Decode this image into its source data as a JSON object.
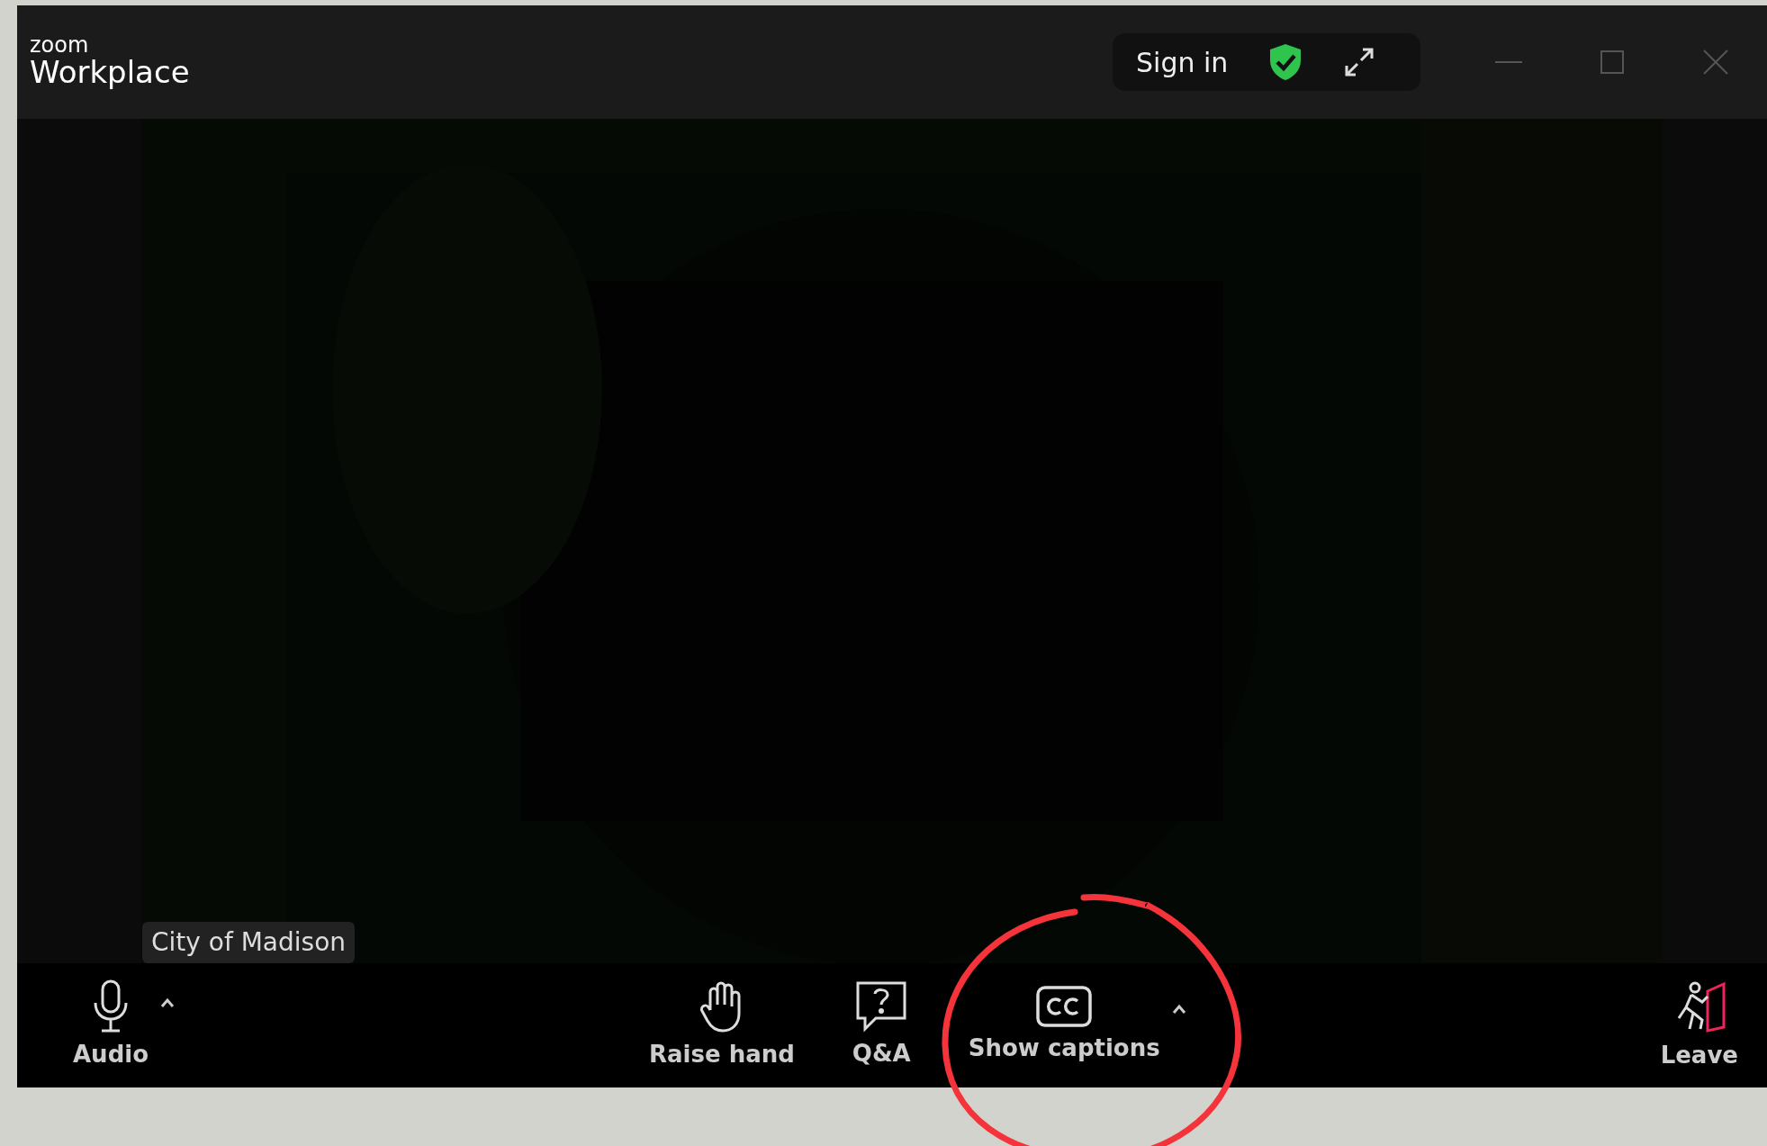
{
  "window": {
    "logo_top": "zoom",
    "logo_bottom": "Workplace"
  },
  "title_bar": {
    "sign_in": "Sign in"
  },
  "video": {
    "kind": "picture",
    "participant_name": "City of Madison"
  },
  "toolbar": [
    {
      "label": "Audio",
      "kind": "audio",
      "has_menu": true,
      "highlighted": false
    },
    {
      "label": "Raise hand",
      "kind": "hand",
      "has_menu": false,
      "highlighted": false
    },
    {
      "label": "Q&A",
      "kind": "qa",
      "has_menu": false,
      "highlighted": false
    },
    {
      "label": "Show captions",
      "kind": "captions",
      "has_menu": true,
      "highlighted": true
    },
    {
      "label": "Leave",
      "kind": "leave",
      "has_menu": false,
      "highlighted": false
    }
  ]
}
